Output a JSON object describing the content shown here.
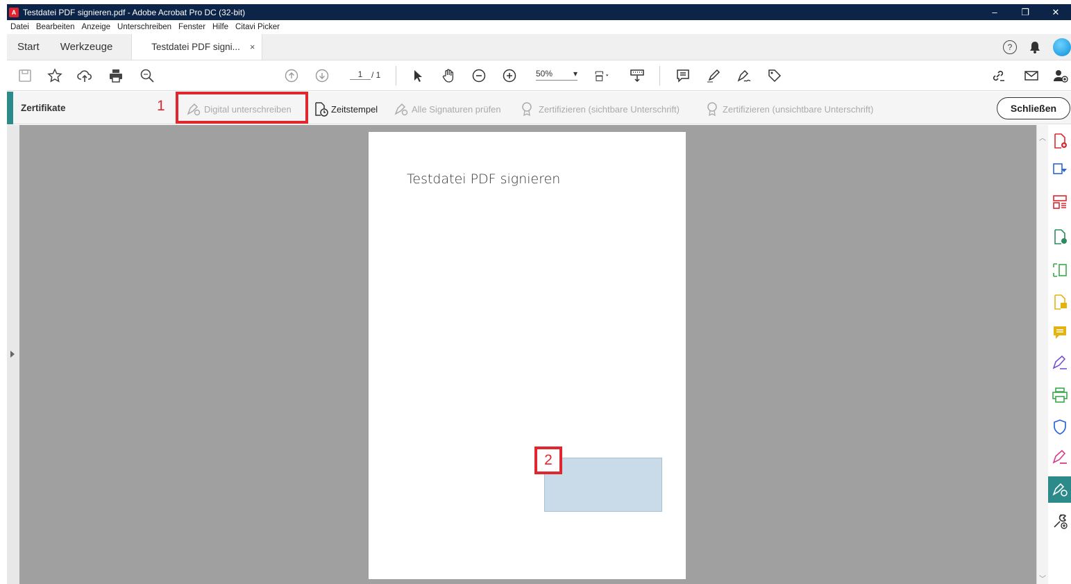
{
  "window": {
    "title": "Testdatei PDF signieren.pdf - Adobe Acrobat Pro DC (32-bit)",
    "minimize": "–",
    "maximize": "❐",
    "close": "✕"
  },
  "menu": [
    "Datei",
    "Bearbeiten",
    "Anzeige",
    "Unterschreiben",
    "Fenster",
    "Hilfe",
    "Citavi Picker"
  ],
  "tabs": {
    "start": "Start",
    "tools": "Werkzeuge",
    "document": "Testdatei PDF signi...",
    "close_glyph": "×"
  },
  "toolbar": {
    "page_current": "1",
    "page_total": "/ 1",
    "zoom": "50%",
    "zoom_arrow": "▾"
  },
  "certbar": {
    "title": "Zertifikate",
    "marker1": "1",
    "digital_sign": "Digital unterschreiben",
    "timestamp": "Zeitstempel",
    "verify_all": "Alle Signaturen prüfen",
    "certify_visible": "Zertifizieren (sichtbare Unterschrift)",
    "certify_invisible": "Zertifizieren (unsichtbare Unterschrift)",
    "close": "Schließen"
  },
  "document": {
    "heading": "Testdatei PDF signieren",
    "marker2": "2"
  },
  "colors": {
    "titlebar": "#0b2447",
    "accent": "#2c8a8a",
    "highlight": "#e0262f",
    "signature_field": "#c9dbe9"
  },
  "right_panel_icons": [
    "create-pdf-icon",
    "export-pdf-icon",
    "organize-pages-icon",
    "edit-pdf-icon",
    "scan-ocr-icon",
    "combine-files-icon",
    "comment-icon",
    "fill-sign-icon",
    "print-production-icon",
    "protect-icon",
    "request-signature-icon",
    "certificates-icon",
    "more-tools-icon"
  ]
}
